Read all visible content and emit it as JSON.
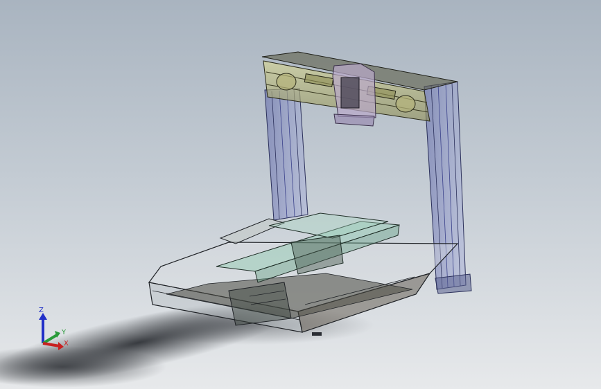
{
  "viewport": {
    "background_top": "#a9b4c0",
    "background_bottom": "#e7e9eb"
  },
  "model": {
    "description_icon": "cnc-gantry-assembly",
    "frame_color": "#6a74b8",
    "slide_color": "#c8c98a",
    "carriage_color": "#b9a8c9",
    "table_color": "#8fc9b0"
  },
  "triad": {
    "z_label": "Z",
    "y_label": "Y",
    "x_label": "X",
    "z_color": "#2230c8",
    "y_color": "#2a9a3a",
    "x_color": "#c82020"
  }
}
